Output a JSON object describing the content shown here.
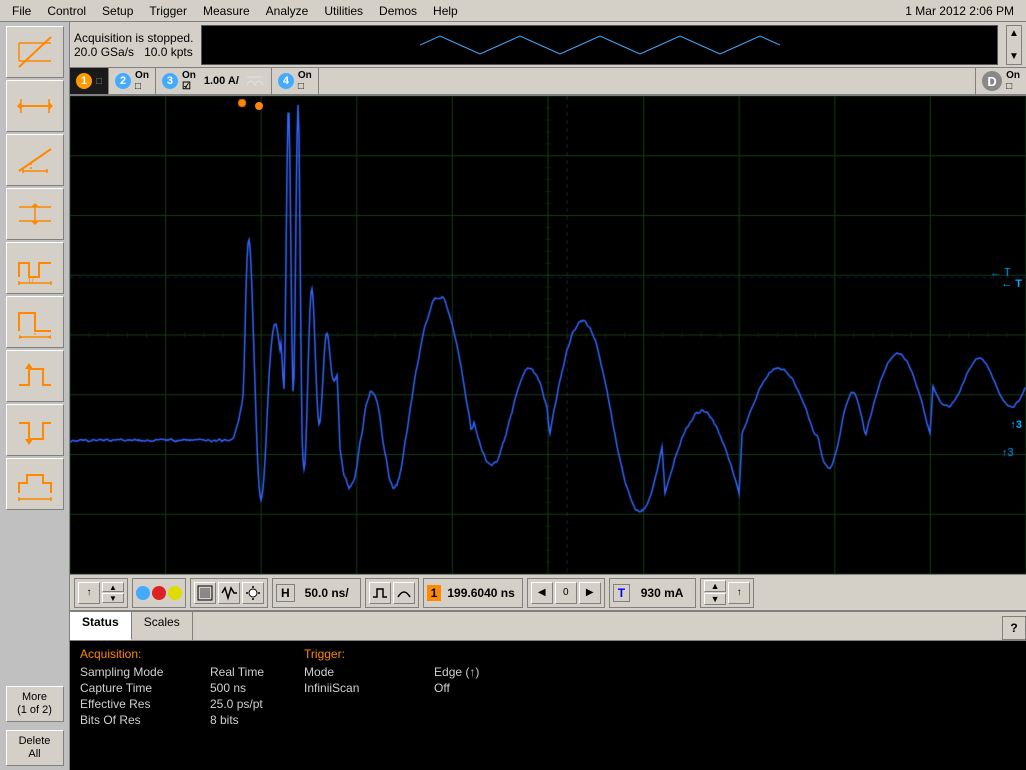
{
  "menubar": {
    "items": [
      "File",
      "Control",
      "Setup",
      "Trigger",
      "Measure",
      "Analyze",
      "Utilities",
      "Demos",
      "Help"
    ],
    "datetime": "1 Mar 2012  2:06 PM"
  },
  "acquisition": {
    "status": "Acquisition is stopped.",
    "rate": "20.0 GSa/s",
    "points": "10.0 kpts"
  },
  "channels": [
    {
      "num": "1",
      "on": false,
      "label": ""
    },
    {
      "num": "2",
      "on": true,
      "label": "On"
    },
    {
      "num": "3",
      "on": true,
      "label": "On",
      "extra": "1.00 A/"
    },
    {
      "num": "4",
      "on": true,
      "label": "On"
    },
    {
      "num": "D",
      "on": true,
      "label": "On"
    }
  ],
  "toolbar": {
    "h_label": "H",
    "h_value": "50.0 ns/",
    "trigger_num": "1",
    "trigger_value": "199.6040 ns",
    "t_label": "T",
    "t_value": "930 mA",
    "arrows": [
      "◀",
      "▶"
    ]
  },
  "tabs": [
    "Status",
    "Scales"
  ],
  "status": {
    "acquisition_title": "Acquisition:",
    "fields": [
      {
        "key": "Sampling Mode",
        "val": "Real Time"
      },
      {
        "key": "Capture Time",
        "val": "500 ns"
      },
      {
        "key": "Effective Res",
        "val": "25.0 ps/pt"
      },
      {
        "key": "Bits Of Res",
        "val": "8 bits"
      }
    ],
    "trigger_title": "Trigger:",
    "trigger_fields": [
      {
        "key": "Mode",
        "val": "Edge (↑)"
      },
      {
        "key": "",
        "val": ""
      },
      {
        "key": "InfiniiScan",
        "val": "Off"
      }
    ]
  },
  "toolbar_buttons": {
    "more_label": "More\n(1 of 2)",
    "delete_label": "Delete\nAll"
  },
  "icons": {
    "tool1": "diagonal-line",
    "tool2": "horizontal-arrows",
    "tool3": "angled-line",
    "tool4": "double-horizontal",
    "tool5": "step-measure",
    "tool6": "pulse-width",
    "tool7": "rising-pulse",
    "tool8": "falling-pulse",
    "tool9": "step-complex"
  },
  "colors": {
    "ch1": "#ff8800",
    "ch2": "#44aaff",
    "ch3": "#44aaff",
    "ch4": "#44aaff",
    "waveform": "#3366ff",
    "grid": "#1a3a1a",
    "background": "#000000"
  }
}
